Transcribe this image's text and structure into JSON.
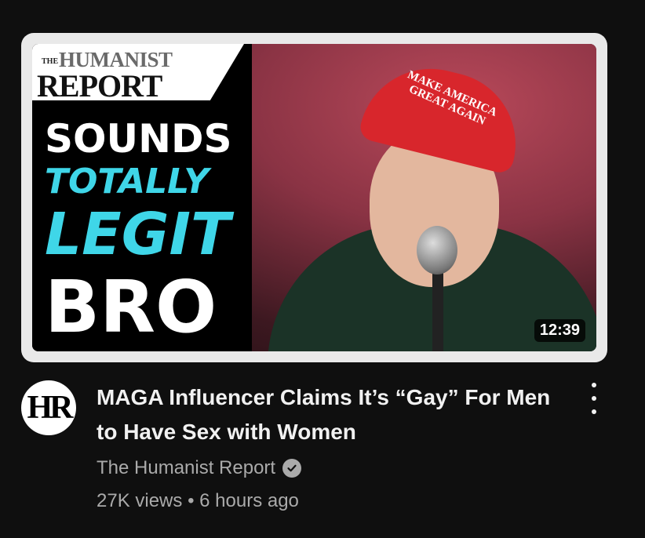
{
  "thumbnail": {
    "logo_the": "THE",
    "logo_humanist": "HUMANIST",
    "logo_report": "REPORT",
    "line1": "SOUNDS",
    "line2": "TOTALLY",
    "line3": "LEGIT",
    "line4": "BRO",
    "hat_text": "MAKE AMERICA GREAT AGAIN",
    "duration": "12:39"
  },
  "video": {
    "avatar_text": "HR",
    "title": "MAGA Influencer Claims It’s “Gay” For Men to Have Sex with Women",
    "channel": "The Humanist Report",
    "views": "27K views",
    "separator": "•",
    "age": "6 hours ago"
  },
  "icons": {
    "verified": "verified-check-icon",
    "menu": "more-vert-icon"
  },
  "colors": {
    "background": "#0f0f0f",
    "title": "#f1f1f1",
    "secondary": "#aaaaaa",
    "accent_cyan": "#3fd6e8",
    "hat_red": "#d8262c"
  }
}
